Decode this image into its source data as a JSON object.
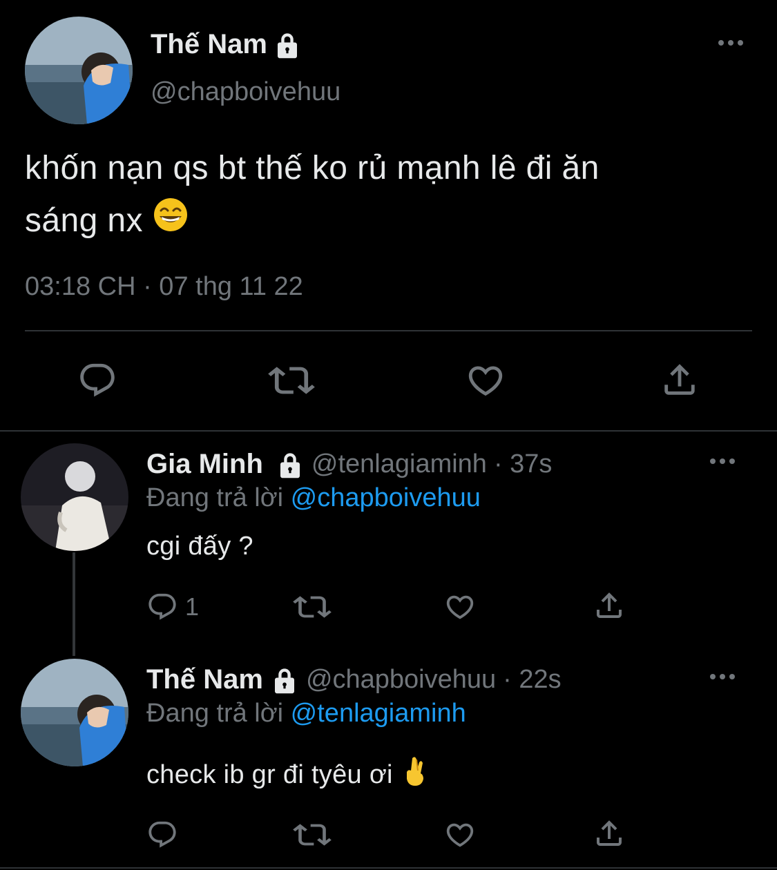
{
  "main_tweet": {
    "author_name": "Thế Nam",
    "author_handle": "@chapboivehuu",
    "text_line1": "khốn nạn qs bt thế ko rủ mạnh lê đi ăn",
    "text_line2": "sáng nx",
    "emoji": "grinning-face",
    "timestamp": "03:18 CH · 07 thg 11 22"
  },
  "replies": [
    {
      "author_name": "Gia Minh",
      "author_handle": "@tenlagiaminh",
      "time": "· 37s",
      "replying_label": "Đang trả lời",
      "replying_to": "@chapboivehuu",
      "text": "cgi đấy ?",
      "reply_count": "1"
    },
    {
      "author_name": "Thế Nam",
      "author_handle": "@chapboivehuu",
      "time": "· 22s",
      "replying_label": "Đang trả lời",
      "replying_to": "@tenlagiaminh",
      "text": "check ib gr đi tyêu ơi",
      "emoji": "crossed-fingers"
    }
  ],
  "icons": [
    "lock-icon",
    "more-icon",
    "reply-icon",
    "retweet-icon",
    "like-icon",
    "share-icon"
  ],
  "colors": {
    "background": "#000000",
    "text": "#e7e9ea",
    "muted": "#71767b",
    "link": "#1d9bf0",
    "divider": "#2f3336"
  }
}
